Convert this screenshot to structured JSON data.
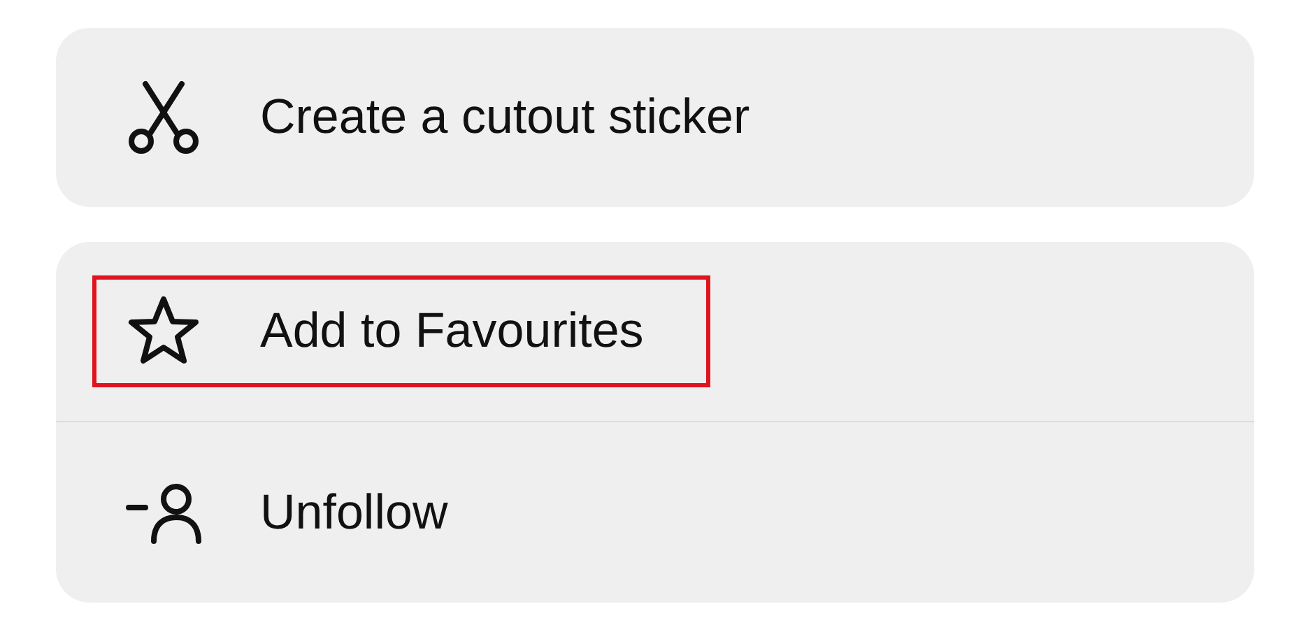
{
  "groups": [
    {
      "items": [
        {
          "kind": "scissors",
          "label": "Create a cutout sticker",
          "highlighted": false
        }
      ]
    },
    {
      "items": [
        {
          "kind": "star",
          "label": "Add to Favourites",
          "highlighted": true
        },
        {
          "kind": "unfollow",
          "label": "Unfollow",
          "highlighted": false
        }
      ]
    }
  ]
}
